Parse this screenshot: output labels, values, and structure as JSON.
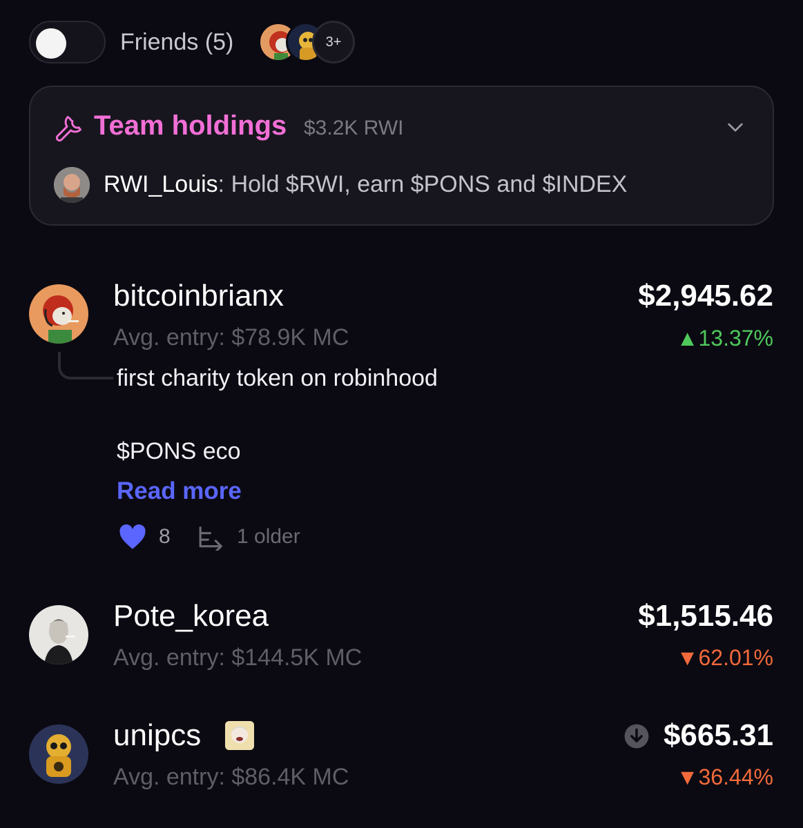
{
  "friends": {
    "label": "Friends (5)",
    "more_count": "3+",
    "toggle_on": false
  },
  "team_holdings": {
    "title": "Team holdings",
    "amount": "$3.2K RWI",
    "author": "RWI_Louis",
    "message": ": Hold $RWI, earn $PONS and $INDEX"
  },
  "holders": [
    {
      "name": "bitcoinbrianx",
      "avg_entry": "Avg. entry: $78.9K MC",
      "value": "$2,945.62",
      "change": "▲13.37%",
      "change_direction": "up",
      "comment": {
        "line1": "first charity token on robinhood",
        "line2": "$PONS eco",
        "read_more": "Read more",
        "likes": "8",
        "older": "1 older"
      }
    },
    {
      "name": "Pote_korea",
      "avg_entry": "Avg. entry: $144.5K MC",
      "value": "$1,515.46",
      "change": "▼62.01%",
      "change_direction": "down"
    },
    {
      "name": "unipcs",
      "avg_entry": "Avg. entry: $86.4K MC",
      "value": "$665.31",
      "change": "▼36.44%",
      "change_direction": "down"
    }
  ],
  "colors": {
    "background": "#0b0a12",
    "accent_pink": "#f26fd6",
    "link_blue": "#5a66ff",
    "positive": "#4fc85c",
    "negative": "#f26a3b"
  }
}
